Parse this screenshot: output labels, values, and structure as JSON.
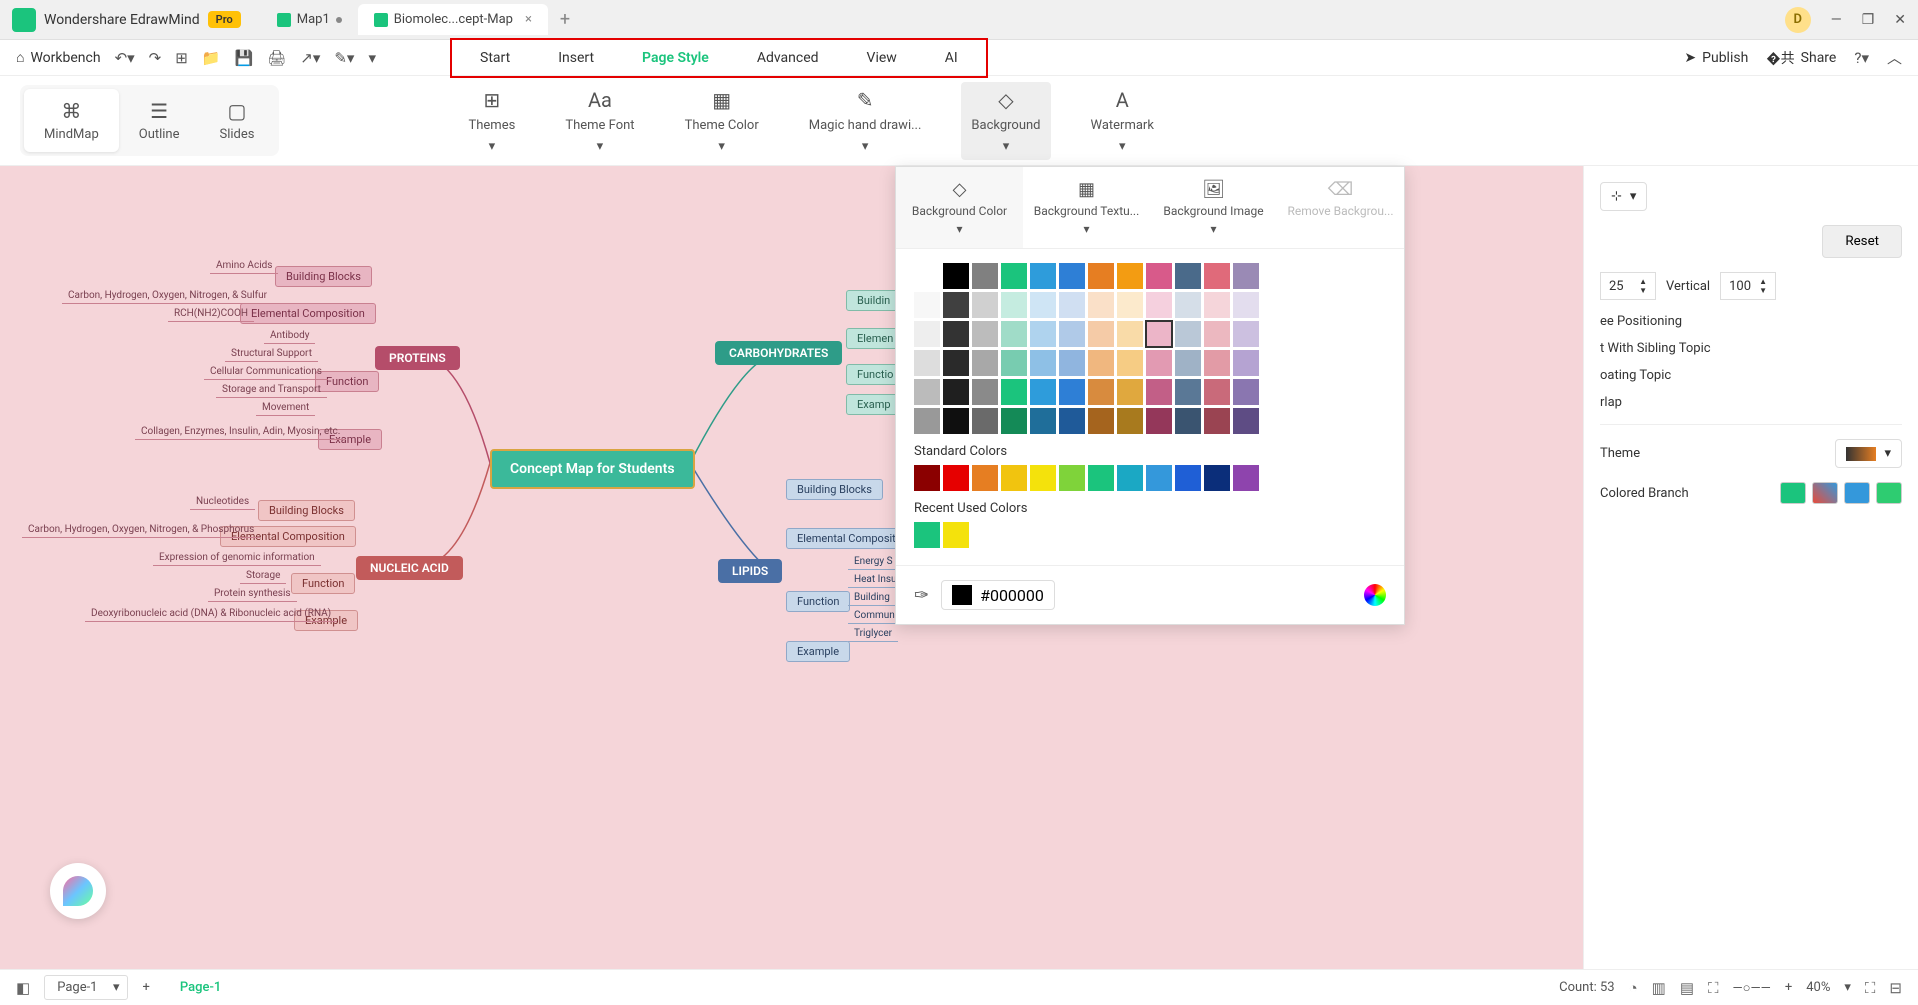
{
  "app": {
    "name": "Wondershare EdrawMind",
    "badge": "Pro",
    "avatar": "D"
  },
  "tabs": [
    {
      "label": "Map1",
      "active": false
    },
    {
      "label": "Biomolec...cept-Map",
      "active": true
    }
  ],
  "toolbar": {
    "workbench": "Workbench"
  },
  "mainmenu": [
    "Start",
    "Insert",
    "Page Style",
    "Advanced",
    "View",
    "AI"
  ],
  "mainmenu_active": 2,
  "topright": {
    "publish": "Publish",
    "share": "Share"
  },
  "viewmodes": [
    "MindMap",
    "Outline",
    "Slides"
  ],
  "viewmodes_active": 0,
  "ribbon": [
    "Themes",
    "Theme Font",
    "Theme Color",
    "Magic hand drawi...",
    "Background",
    "Watermark"
  ],
  "ribbon_active": 4,
  "bgpanel": {
    "tabs": [
      "Background Color",
      "Background Textu...",
      "Background Image",
      "Remove Backgrou..."
    ],
    "tabs_active": 0,
    "standard_label": "Standard Colors",
    "recent_label": "Recent Used Colors",
    "hex": "#000000",
    "theme_colors": [
      [
        "#ffffff",
        "#000000",
        "#808080",
        "#1bc47d",
        "#2e9cdb",
        "#2e7fd6",
        "#e67e22",
        "#f39c12",
        "#d85a8a",
        "#4a6a8a",
        "#e06a7a",
        "#9a8ab5"
      ],
      [
        "#f7f7f7",
        "#404040",
        "#d0d0d0",
        "#c5ece0",
        "#cfe5f5",
        "#d0dff2",
        "#fae0c8",
        "#fceacc",
        "#f5d0de",
        "#d5dee8",
        "#f5d5da",
        "#e3ddee"
      ],
      [
        "#eeeeee",
        "#333333",
        "#bcbcbc",
        "#a0dcc8",
        "#afd3ee",
        "#b0cae8",
        "#f5cba7",
        "#f9dba8",
        "#ecb5c8",
        "#bac8d7",
        "#ecb8c0",
        "#ccc0e0"
      ],
      [
        "#dddddd",
        "#2a2a2a",
        "#a8a8a8",
        "#78ccb0",
        "#8ec0e6",
        "#90b5df",
        "#f0b77f",
        "#f6cc84",
        "#e29ab2",
        "#9fb2c6",
        "#e29ba6",
        "#b5a3d2"
      ],
      [
        "#bbbbbb",
        "#1f1f1f",
        "#8a8a8a",
        "#1bc47d",
        "#2e9cdb",
        "#2e7fd6",
        "#d88b3e",
        "#e0a83e",
        "#c25f87",
        "#5a7896",
        "#c96a7a",
        "#8a76b0"
      ],
      [
        "#999999",
        "#0f0f0f",
        "#6a6a6a",
        "#148a57",
        "#1f6e9a",
        "#1f5a99",
        "#a5641e",
        "#a87a1e",
        "#94375a",
        "#3a5470",
        "#9a4452",
        "#5e4c84"
      ]
    ],
    "standard_colors": [
      "#8b0000",
      "#e60000",
      "#e67e22",
      "#f1c40f",
      "#f4e20c",
      "#7fd33a",
      "#1bc47d",
      "#1ba8c4",
      "#3498db",
      "#1f5fd6",
      "#0b2e7a",
      "#8e44ad"
    ],
    "recent_colors": [
      "#1bc47d",
      "#f4e20c"
    ]
  },
  "mindmap": {
    "central": "Concept Map for Students",
    "branches": {
      "proteins": {
        "label": "PROTEINS",
        "color": "#b54d6a",
        "children": {
          "building": {
            "label": "Building Blocks",
            "items": [
              "Amino Acids"
            ]
          },
          "elemental": {
            "label": "Elemental Composition",
            "items": [
              "Carbon, Hydrogen, Oxygen, Nitrogen, & Sulfur",
              "RCH(NH2)COOH"
            ]
          },
          "function": {
            "label": "Function",
            "items": [
              "Antibody",
              "Structural Support",
              "Cellular Communications",
              "Storage and Transport",
              "Movement"
            ]
          },
          "example": {
            "label": "Example",
            "items": [
              "Collagen, Enzymes, Insulin, Adin, Myosin, etc."
            ]
          }
        }
      },
      "nucleic": {
        "label": "NUCLEIC ACID",
        "color": "#c25b5b",
        "children": {
          "building": {
            "label": "Building Blocks",
            "items": [
              "Nucleotides"
            ]
          },
          "elemental": {
            "label": "Elemental Composition",
            "items": [
              "Carbon, Hydrogen, Oxygen, Nitrogen, & Phosphorus"
            ]
          },
          "function": {
            "label": "Function",
            "items": [
              "Expression of genomic information",
              "Storage",
              "Protein synthesis"
            ]
          },
          "example": {
            "label": "Example",
            "items": [
              "Deoxyribonucleic acid (DNA) & Ribonucleic acid (RNA)"
            ]
          }
        }
      },
      "carbo": {
        "label": "CARBOHYDRATES",
        "color": "#2e9c88",
        "children": {
          "building": {
            "label": "Buildin"
          },
          "elemental": {
            "label": "Elemen"
          },
          "function": {
            "label": "Functio"
          },
          "example": {
            "label": "Examp"
          }
        }
      },
      "lipids": {
        "label": "LIPIDS",
        "color": "#4a6fa5",
        "children": {
          "building": {
            "label": "Building Blocks"
          },
          "elemental": {
            "label": "Elemental Compositi"
          },
          "function": {
            "label": "Function",
            "items": [
              "Energy S",
              "Heat Insu",
              "Building",
              "Commun",
              "Triglycer"
            ]
          },
          "example": {
            "label": "Example"
          }
        }
      }
    }
  },
  "rpanel": {
    "reset": "Reset",
    "num1": "25",
    "vertical_label": "Vertical",
    "vertical_val": "100",
    "opts": [
      "ee Positioning",
      "t With Sibling Topic",
      "oating Topic",
      "rlap"
    ],
    "theme_label": "Theme",
    "branch_label": "Colored Branch"
  },
  "status": {
    "page_sel": "Page-1",
    "page_active": "Page-1",
    "count": "Count: 53",
    "zoom": "40%"
  }
}
